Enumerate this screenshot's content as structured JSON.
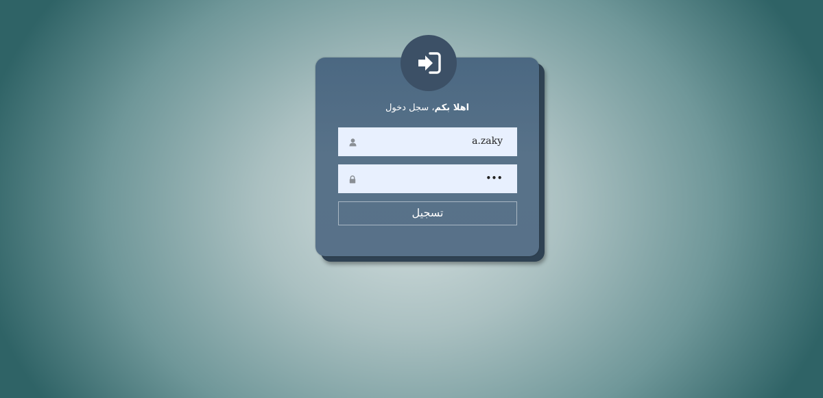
{
  "login": {
    "welcome_bold": "اهلا بكم",
    "welcome_rest": "، سجل دخول",
    "username": {
      "value": "a.zaky",
      "icon": "user-icon"
    },
    "password": {
      "value": "•••",
      "icon": "lock-icon"
    },
    "submit_label": "تسجيل",
    "header_icon": "sign-in-icon"
  },
  "colors": {
    "card": "#587289",
    "icon_circle": "#3c5066",
    "field_bg": "#e8f0fe"
  }
}
